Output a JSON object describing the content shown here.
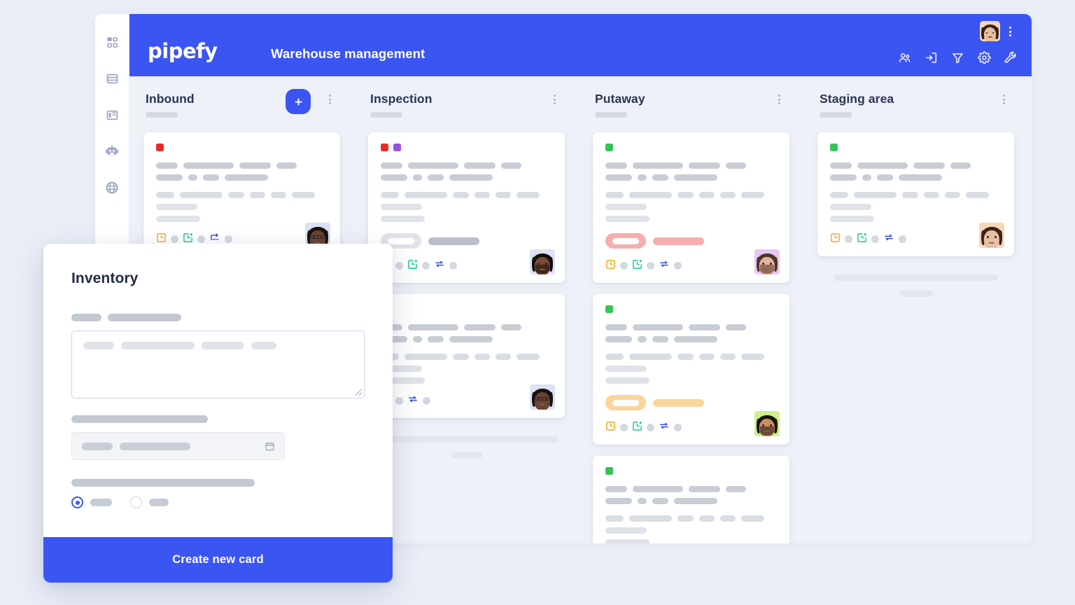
{
  "app": {
    "brand": "pipefy",
    "board_title": "Warehouse management",
    "brand_color": "#3b55f3",
    "page_background": "#eaeef7",
    "board_background": "#eef1f8"
  },
  "sidebar": {
    "items": [
      {
        "name": "dashboard-icon",
        "label": "Dashboard"
      },
      {
        "name": "database-icon",
        "label": "Database"
      },
      {
        "name": "layout-icon",
        "label": "Layout"
      },
      {
        "name": "robot-icon",
        "label": "Automation"
      },
      {
        "name": "globe-icon",
        "label": "Public form"
      }
    ]
  },
  "topbar": {
    "icons": [
      {
        "name": "members-icon",
        "label": "Members"
      },
      {
        "name": "import-icon",
        "label": "Import"
      },
      {
        "name": "filter-icon",
        "label": "Filter"
      },
      {
        "name": "gear-icon",
        "label": "Settings"
      },
      {
        "name": "wrench-icon",
        "label": "Tools"
      }
    ],
    "avatar_label": "User avatar",
    "kebab_label": "More options"
  },
  "board": {
    "columns": [
      {
        "title": "Inbound",
        "has_add_button": true,
        "add_label": "+",
        "cards": [
          {
            "tags": [
              "#e82a2a"
            ],
            "avatar": {
              "skin": "#6b4332",
              "hair": "#171311",
              "bg": "#dde2f4",
              "glasses": true,
              "beard": false
            },
            "badge": null,
            "footer_icons": [
              "clock-orange-icon",
              "calendar-green-icon",
              "flow-blue-icon"
            ]
          }
        ],
        "ghost_bars": []
      },
      {
        "title": "Inspection",
        "has_add_button": false,
        "cards": [
          {
            "tags": [
              "#e82a2a",
              "#9b51e0"
            ],
            "avatar": {
              "skin": "#7a4a33",
              "hair": "#120e0c",
              "bg": "#dde2f4",
              "glasses": false,
              "beard": true
            },
            "badge": {
              "box": "#e0e3e9",
              "bar": "#b9bec9"
            },
            "footer_icons": [
              "clock-orange-icon",
              "calendar-green-icon",
              "repeat-blue-icon"
            ]
          },
          {
            "tags": [],
            "avatar": {
              "skin": "#6b4332",
              "hair": "#171311",
              "bg": "#dde2f4",
              "glasses": true,
              "beard": false
            },
            "badge": null,
            "footer_icons": [
              "calendar-green-icon",
              "repeat-blue-icon"
            ]
          }
        ],
        "ghost_bars": [
          260,
          44
        ]
      },
      {
        "title": "Putaway",
        "has_add_button": false,
        "cards": [
          {
            "tags": [
              "#33c458"
            ],
            "avatar": {
              "skin": "#e6b49b",
              "hair": "#4a3328",
              "bg": "#e6c9f2",
              "glasses": false,
              "beard": true
            },
            "badge": {
              "box": "#f7aeae",
              "bar": "#f7aeae"
            },
            "footer_icons": [
              "clock-orange-icon",
              "calendar-green-icon",
              "repeat-blue-icon"
            ]
          },
          {
            "tags": [
              "#33c458"
            ],
            "avatar": {
              "skin": "#c98f63",
              "hair": "#1a120c",
              "bg": "#ccf08a",
              "glasses": false,
              "beard": true
            },
            "badge": {
              "box": "#fad69b",
              "bar": "#fad69b"
            },
            "footer_icons": [
              "clock-orange-icon",
              "calendar-green-icon",
              "repeat-blue-icon"
            ]
          },
          {
            "tags": [
              "#33c458"
            ],
            "avatar": {
              "skin": "#6b4332",
              "hair": "#120d0a",
              "bg": "#dbd9f7",
              "glasses": false,
              "beard": true
            },
            "badge": {
              "box": "#fad69b",
              "bar": "#fad69b"
            },
            "footer_icons": [
              "clock-orange-icon",
              "calendar-green-icon",
              "repeat-blue-icon"
            ]
          }
        ],
        "ghost_bars": []
      },
      {
        "title": "Staging area",
        "has_add_button": false,
        "cards": [
          {
            "tags": [
              "#33c458"
            ],
            "avatar": {
              "skin": "#e8bfa0",
              "hair": "#3a2118",
              "bg": "#f5d7b8",
              "glasses": false,
              "beard": false
            },
            "badge": null,
            "footer_icons": [
              "clock-orange-icon",
              "calendar-green-icon",
              "repeat-blue-icon"
            ]
          }
        ],
        "ghost_bars": [
          235,
          48
        ]
      }
    ]
  },
  "modal": {
    "title": "Inventory",
    "submit_label": "Create new card",
    "fields": {
      "textarea_name": "description-textarea",
      "date_name": "due-date-field",
      "date_icon": "calendar-icon",
      "radio_group_name": "option-radio-group",
      "radio_selected_index": 0,
      "radio_count": 2
    }
  }
}
